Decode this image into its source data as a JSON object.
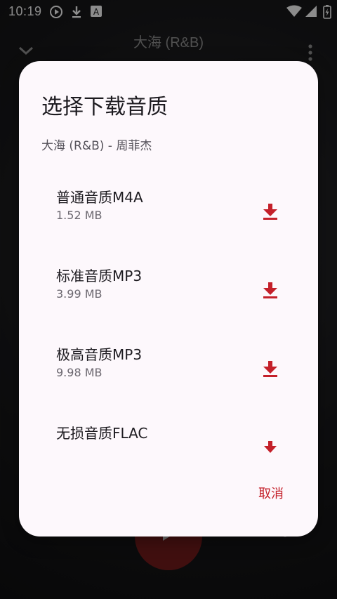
{
  "status_bar": {
    "time": "10:19"
  },
  "player": {
    "title": "大海 (R&B)"
  },
  "dialog": {
    "title": "选择下载音质",
    "subtitle": "大海 (R&B) - 周菲杰",
    "options": [
      {
        "label": "普通音质M4A",
        "size": "1.52 MB"
      },
      {
        "label": "标准音质MP3",
        "size": "3.99 MB"
      },
      {
        "label": "极高音质MP3",
        "size": "9.98 MB"
      },
      {
        "label": "无损音质FLAC",
        "size": ""
      }
    ],
    "cancel_label": "取消"
  },
  "colors": {
    "accent": "#c4202a",
    "dialog_bg": "#fdf8fc"
  }
}
